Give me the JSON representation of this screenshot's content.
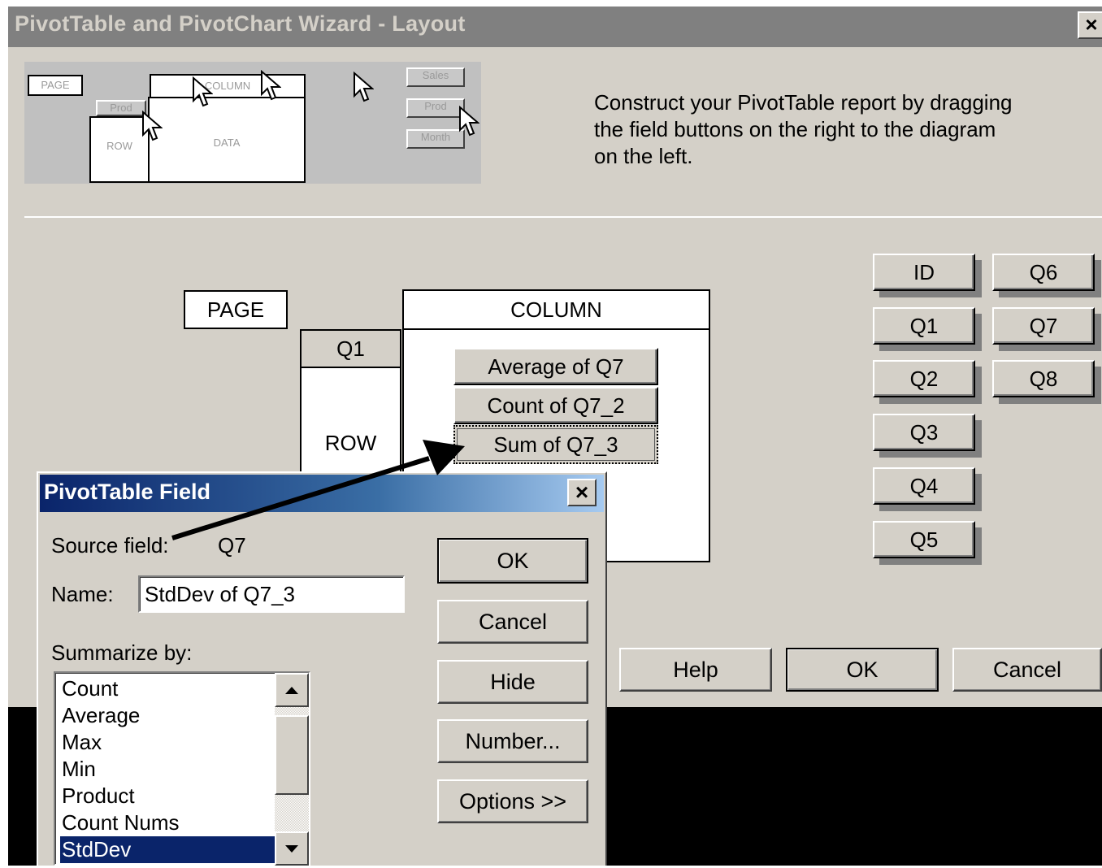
{
  "wizard": {
    "title": "PivotTable and PivotChart Wizard - Layout",
    "close": "×",
    "instructions": "Construct your PivotTable report by dragging the field buttons on the right to the diagram on the left.",
    "thumbnail": {
      "page": "PAGE",
      "column": "COLUMN",
      "prod": "Prod",
      "row": "ROW",
      "data": "DATA",
      "sales": "Sales",
      "prod2": "Prod",
      "month": "Month"
    },
    "layout": {
      "page": "PAGE",
      "column": "COLUMN",
      "row": "ROW",
      "row_field": "Q1",
      "data_fields": [
        "Average of Q7",
        "Count of Q7_2",
        "Sum of Q7_3"
      ]
    },
    "fields": [
      "ID",
      "Q6",
      "Q1",
      "Q7",
      "Q2",
      "Q8",
      "Q3",
      "Q4",
      "Q5"
    ],
    "buttons": {
      "help": "Help",
      "ok": "OK",
      "cancel": "Cancel"
    }
  },
  "field_dialog": {
    "title": "PivotTable Field",
    "close": "×",
    "source_label": "Source field:",
    "source_value": "Q7",
    "name_label": "Name:",
    "name_value": "StdDev of Q7_3",
    "summarize_label": "Summarize by:",
    "summarize_options": [
      "Count",
      "Average",
      "Max",
      "Min",
      "Product",
      "Count Nums",
      "StdDev"
    ],
    "selected": "StdDev",
    "buttons": {
      "ok": "OK",
      "cancel": "Cancel",
      "hide": "Hide",
      "number": "Number...",
      "options": "Options >>"
    }
  }
}
